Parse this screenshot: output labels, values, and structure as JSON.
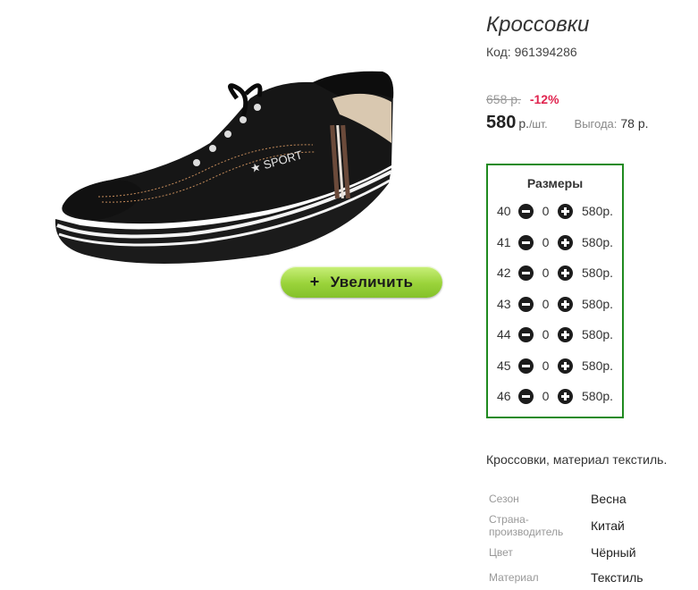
{
  "product": {
    "title": "Кроссовки",
    "code": "Код: 961394286",
    "shoe_logo_text": "★ SPORT",
    "zoom_button": {
      "plus": "+",
      "label": "Увеличить"
    }
  },
  "pricing": {
    "old_price": "658 р.",
    "discount": "-12%",
    "price": "580",
    "currency": "р.",
    "per_unit": "/шт.",
    "saving_label": "Выгода:",
    "saving_value": "78 р."
  },
  "sizes": {
    "title": "Размеры",
    "rows": [
      {
        "size": "40",
        "qty": "0",
        "price": "580р."
      },
      {
        "size": "41",
        "qty": "0",
        "price": "580р."
      },
      {
        "size": "42",
        "qty": "0",
        "price": "580р."
      },
      {
        "size": "43",
        "qty": "0",
        "price": "580р."
      },
      {
        "size": "44",
        "qty": "0",
        "price": "580р."
      },
      {
        "size": "45",
        "qty": "0",
        "price": "580р."
      },
      {
        "size": "46",
        "qty": "0",
        "price": "580р."
      }
    ],
    "border_color": "#1f8a1f"
  },
  "description": "Кроссовки, материал текстиль.",
  "attributes": [
    {
      "label": "Сезон",
      "value": "Весна"
    },
    {
      "label": "Страна-производитель",
      "value": "Китай"
    },
    {
      "label": "Цвет",
      "value": "Чёрный"
    },
    {
      "label": "Материал",
      "value": "Текстиль"
    }
  ],
  "colors": {
    "discount": "#e0244f",
    "zoom_button": "#9ad33a"
  }
}
